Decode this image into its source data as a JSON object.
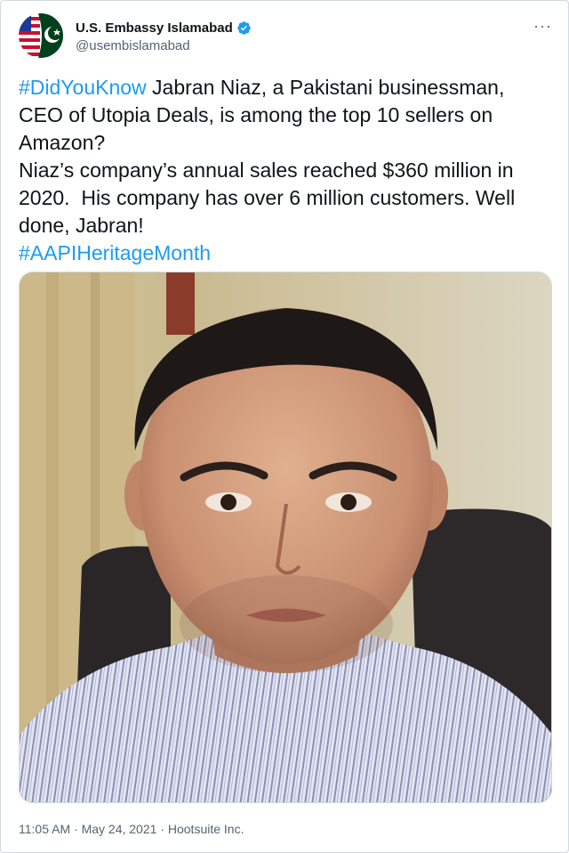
{
  "account": {
    "display_name": "U.S. Embassy Islamabad",
    "handle": "@usembislamabad",
    "verified": true,
    "avatar_icon": "us-pakistan-flag-avatar"
  },
  "menu": {
    "more_label": "···"
  },
  "tweet": {
    "hashtag_1": "#DidYouKnow",
    "text_1": " Jabran Niaz, a Pakistani businessman, CEO of Utopia Deals, is among the top 10 sellers on Amazon?\nNiaz’s company’s annual sales reached $360 million in 2020.  His company has over 6 million customers. Well done, Jabran!\n",
    "hashtag_2": "#AAPIHeritageMonth"
  },
  "media": {
    "description": "photo"
  },
  "footer": {
    "time": "11:05 AM",
    "separator_1": " · ",
    "date": "May 24, 2021",
    "separator_2": " · ",
    "source": "Hootsuite Inc."
  },
  "colors": {
    "link": "#1d9bf0",
    "text": "#0f1419",
    "secondary": "#536471",
    "verified": "#1d9bf0"
  }
}
